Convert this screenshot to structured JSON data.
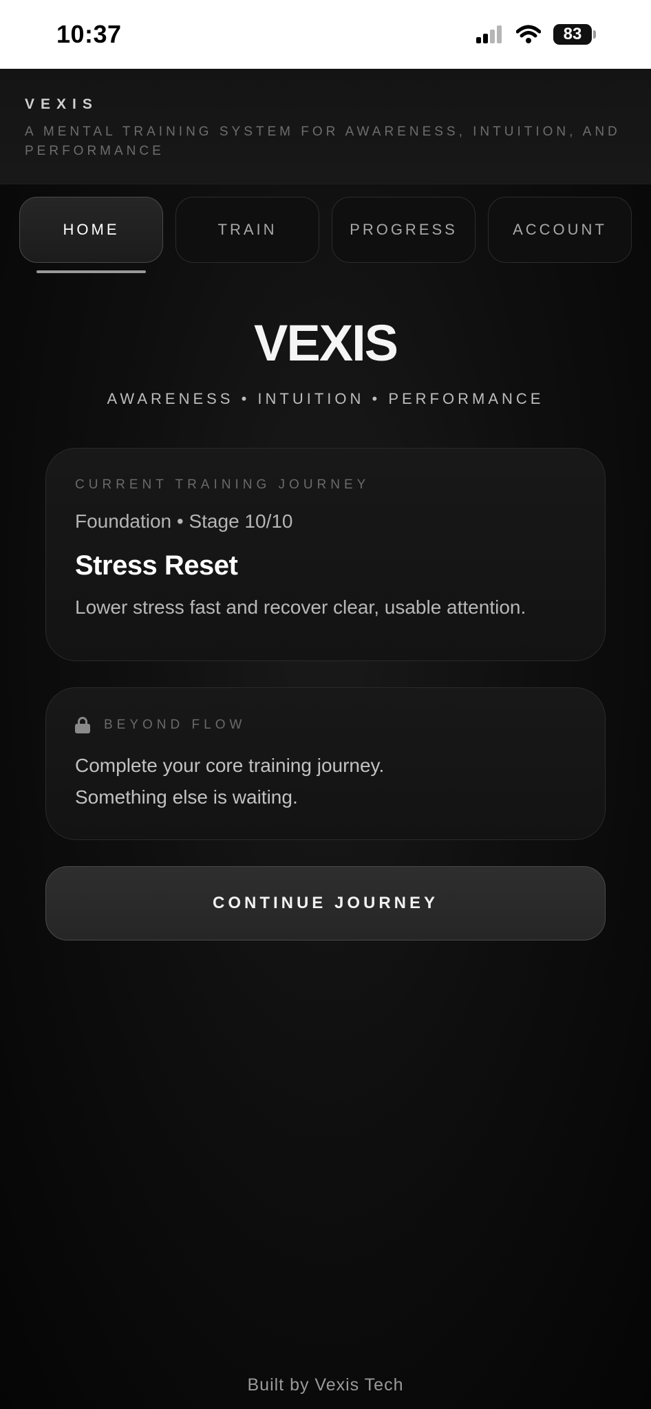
{
  "status_bar": {
    "time": "10:37",
    "battery": "83",
    "icons": [
      "signal-icon",
      "wifi-icon",
      "battery-icon"
    ]
  },
  "header": {
    "brand": "VEXIS",
    "tagline": "A MENTAL TRAINING SYSTEM FOR AWARENESS, INTUITION, AND PERFORMANCE"
  },
  "tabs": [
    {
      "label": "HOME",
      "active": true
    },
    {
      "label": "TRAIN",
      "active": false
    },
    {
      "label": "PROGRESS",
      "active": false
    },
    {
      "label": "ACCOUNT",
      "active": false
    }
  ],
  "hero": {
    "title": "VEXIS",
    "subtitle": "AWARENESS • INTUITION • PERFORMANCE"
  },
  "journey_card": {
    "eyebrow": "CURRENT TRAINING JOURNEY",
    "meta": "Foundation • Stage 10/10",
    "title": "Stress Reset",
    "description": "Lower stress fast and recover clear, usable attention."
  },
  "locked_card": {
    "eyebrow": "BEYOND FLOW",
    "line1": "Complete your core training journey.",
    "line2": "Something else is waiting."
  },
  "cta": {
    "label": "CONTINUE JOURNEY"
  },
  "footer": {
    "text": "Built by Vexis Tech"
  },
  "colors": {
    "background": "#0b0b0b",
    "card": "#161616",
    "accent": "#ffffff"
  }
}
